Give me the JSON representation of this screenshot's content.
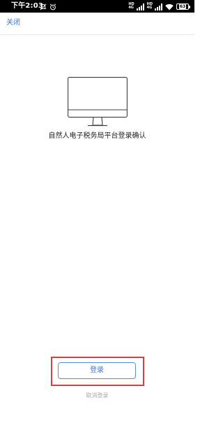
{
  "status_bar": {
    "time": "下午2:03",
    "icons": [
      "muted-icon",
      "alarm-icon",
      "signal-icon",
      "signal-icon",
      "wifi-icon",
      "battery-icon"
    ],
    "signal_label_top": "HD",
    "signal_label_bottom": "4G",
    "battery_level": "63"
  },
  "header": {
    "close_label": "关闭"
  },
  "main": {
    "illustration_icon": "computer-monitor-icon",
    "confirm_text": "自然人电子税务局平台登录确认"
  },
  "actions": {
    "login_label": "登录",
    "cancel_label": "取消登录",
    "highlight_color": "#e23b3b",
    "accent_color": "#3a7ad1"
  }
}
